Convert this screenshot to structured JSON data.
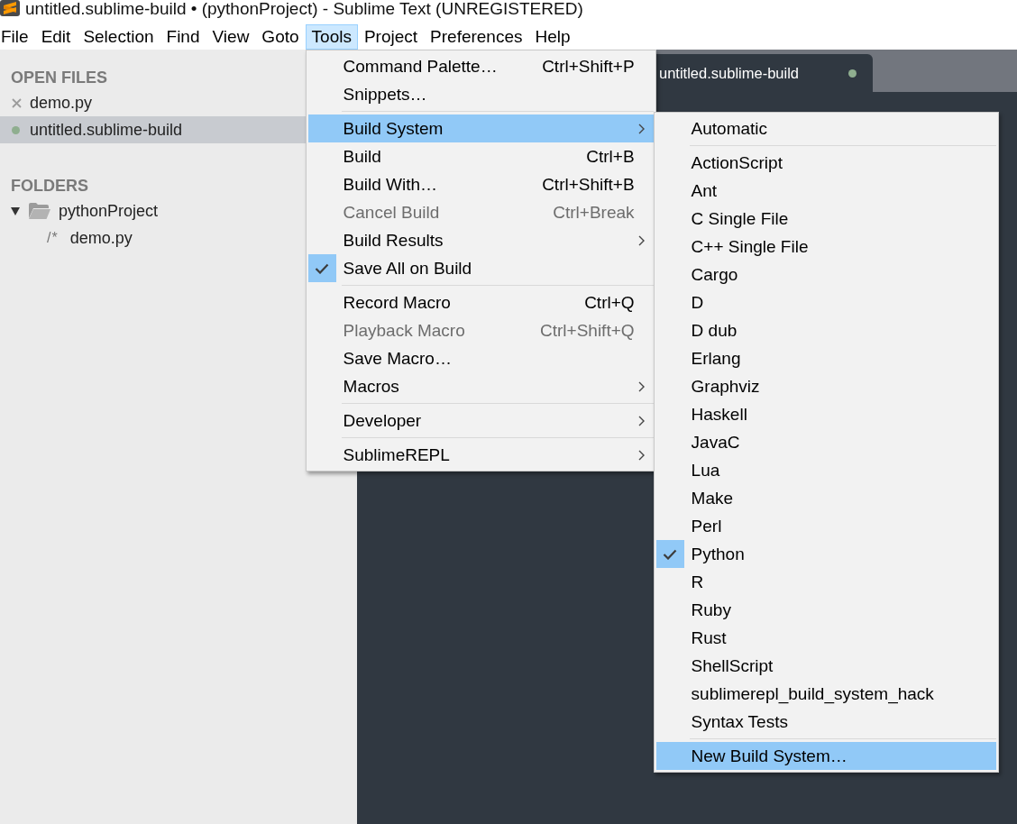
{
  "window": {
    "title": "untitled.sublime-build • (pythonProject) - Sublime Text (UNREGISTERED)"
  },
  "menu_bar": [
    {
      "label": "File",
      "selected": false
    },
    {
      "label": "Edit",
      "selected": false
    },
    {
      "label": "Selection",
      "selected": false
    },
    {
      "label": "Find",
      "selected": false
    },
    {
      "label": "View",
      "selected": false
    },
    {
      "label": "Goto",
      "selected": false
    },
    {
      "label": "Tools",
      "selected": true
    },
    {
      "label": "Project",
      "selected": false
    },
    {
      "label": "Preferences",
      "selected": false
    },
    {
      "label": "Help",
      "selected": false
    }
  ],
  "sidebar": {
    "open_files": {
      "title": "OPEN FILES",
      "items": [
        {
          "name": "demo.py",
          "modified": false,
          "selected": false
        },
        {
          "name": "untitled.sublime-build",
          "modified": true,
          "selected": true
        }
      ]
    },
    "folders": {
      "title": "FOLDERS",
      "items": [
        {
          "name": "pythonProject",
          "kind": "folder",
          "expanded": true,
          "children": [
            {
              "name": "demo.py",
              "kind": "file",
              "glyph": "/*"
            }
          ]
        }
      ]
    }
  },
  "tabs": [
    {
      "label": "untitled.sublime-build",
      "modified": true,
      "selected": true
    }
  ],
  "tools_menu": {
    "items": [
      {
        "kind": "item",
        "label": "Command Palette…",
        "shortcut": "Ctrl+Shift+P",
        "checked": false,
        "disabled": false,
        "selected": false
      },
      {
        "kind": "item",
        "label": "Snippets…",
        "checked": false,
        "disabled": false,
        "selected": false
      },
      {
        "kind": "separator"
      },
      {
        "kind": "submenu",
        "label": "Build System",
        "checked": false,
        "disabled": false,
        "selected": true
      },
      {
        "kind": "item",
        "label": "Build",
        "shortcut": "Ctrl+B",
        "checked": false,
        "disabled": false,
        "selected": false
      },
      {
        "kind": "item",
        "label": "Build With…",
        "shortcut": "Ctrl+Shift+B",
        "checked": false,
        "disabled": false,
        "selected": false
      },
      {
        "kind": "item",
        "label": "Cancel Build",
        "shortcut": "Ctrl+Break",
        "checked": false,
        "disabled": true,
        "selected": false
      },
      {
        "kind": "submenu",
        "label": "Build Results",
        "checked": false,
        "disabled": false,
        "selected": false
      },
      {
        "kind": "item",
        "label": "Save All on Build",
        "checked": true,
        "disabled": false,
        "selected": false
      },
      {
        "kind": "separator"
      },
      {
        "kind": "item",
        "label": "Record Macro",
        "shortcut": "Ctrl+Q",
        "checked": false,
        "disabled": false,
        "selected": false
      },
      {
        "kind": "item",
        "label": "Playback Macro",
        "shortcut": "Ctrl+Shift+Q",
        "checked": false,
        "disabled": true,
        "selected": false
      },
      {
        "kind": "item",
        "label": "Save Macro…",
        "checked": false,
        "disabled": false,
        "selected": false
      },
      {
        "kind": "submenu",
        "label": "Macros",
        "checked": false,
        "disabled": false,
        "selected": false
      },
      {
        "kind": "separator"
      },
      {
        "kind": "submenu",
        "label": "Developer",
        "checked": false,
        "disabled": false,
        "selected": false
      },
      {
        "kind": "separator"
      },
      {
        "kind": "submenu",
        "label": "SublimeREPL",
        "checked": false,
        "disabled": false,
        "selected": false
      }
    ]
  },
  "build_system_menu": {
    "items": [
      {
        "kind": "item",
        "label": "Automatic",
        "checked": false,
        "disabled": false,
        "selected": false
      },
      {
        "kind": "separator"
      },
      {
        "kind": "item",
        "label": "ActionScript",
        "checked": false,
        "disabled": false,
        "selected": false
      },
      {
        "kind": "item",
        "label": "Ant",
        "checked": false,
        "disabled": false,
        "selected": false
      },
      {
        "kind": "item",
        "label": "C Single File",
        "checked": false,
        "disabled": false,
        "selected": false
      },
      {
        "kind": "item",
        "label": "C++ Single File",
        "checked": false,
        "disabled": false,
        "selected": false
      },
      {
        "kind": "item",
        "label": "Cargo",
        "checked": false,
        "disabled": false,
        "selected": false
      },
      {
        "kind": "item",
        "label": "D",
        "checked": false,
        "disabled": false,
        "selected": false
      },
      {
        "kind": "item",
        "label": "D dub",
        "checked": false,
        "disabled": false,
        "selected": false
      },
      {
        "kind": "item",
        "label": "Erlang",
        "checked": false,
        "disabled": false,
        "selected": false
      },
      {
        "kind": "item",
        "label": "Graphviz",
        "checked": false,
        "disabled": false,
        "selected": false
      },
      {
        "kind": "item",
        "label": "Haskell",
        "checked": false,
        "disabled": false,
        "selected": false
      },
      {
        "kind": "item",
        "label": "JavaC",
        "checked": false,
        "disabled": false,
        "selected": false
      },
      {
        "kind": "item",
        "label": "Lua",
        "checked": false,
        "disabled": false,
        "selected": false
      },
      {
        "kind": "item",
        "label": "Make",
        "checked": false,
        "disabled": false,
        "selected": false
      },
      {
        "kind": "item",
        "label": "Perl",
        "checked": false,
        "disabled": false,
        "selected": false
      },
      {
        "kind": "item",
        "label": "Python",
        "checked": true,
        "disabled": false,
        "selected": false
      },
      {
        "kind": "item",
        "label": "R",
        "checked": false,
        "disabled": false,
        "selected": false
      },
      {
        "kind": "item",
        "label": "Ruby",
        "checked": false,
        "disabled": false,
        "selected": false
      },
      {
        "kind": "item",
        "label": "Rust",
        "checked": false,
        "disabled": false,
        "selected": false
      },
      {
        "kind": "item",
        "label": "ShellScript",
        "checked": false,
        "disabled": false,
        "selected": false
      },
      {
        "kind": "item",
        "label": "sublimerepl_build_system_hack",
        "checked": false,
        "disabled": false,
        "selected": false
      },
      {
        "kind": "item",
        "label": "Syntax Tests",
        "checked": false,
        "disabled": false,
        "selected": false
      },
      {
        "kind": "separator"
      },
      {
        "kind": "item",
        "label": "New Build System…",
        "checked": false,
        "disabled": false,
        "selected": true
      }
    ]
  }
}
